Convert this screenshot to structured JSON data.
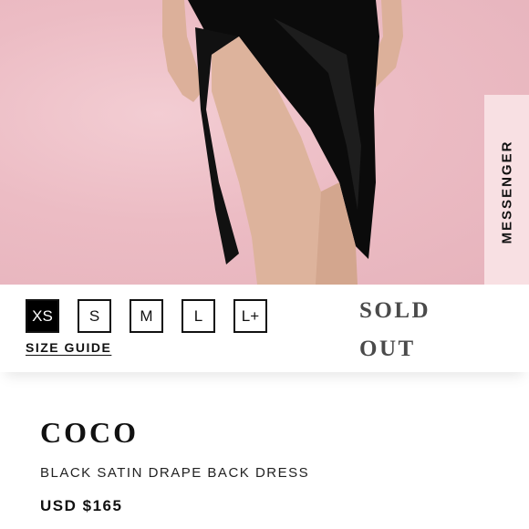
{
  "messenger": {
    "label": "MESSENGER"
  },
  "sizes": [
    {
      "label": "XS",
      "selected": true
    },
    {
      "label": "S",
      "selected": false
    },
    {
      "label": "M",
      "selected": false
    },
    {
      "label": "L",
      "selected": false
    },
    {
      "label": "L+",
      "selected": false
    }
  ],
  "size_guide": {
    "label": "SIZE GUIDE"
  },
  "status": {
    "line1": "SOLD",
    "line2": "OUT"
  },
  "product": {
    "name": "COCO",
    "description": "BLACK SATIN DRAPE BACK DRESS",
    "price": "USD $165"
  },
  "colors": {
    "background_pink": "#ecbcc4",
    "dress": "#0b0b0b",
    "skin": "#ddb39c"
  }
}
